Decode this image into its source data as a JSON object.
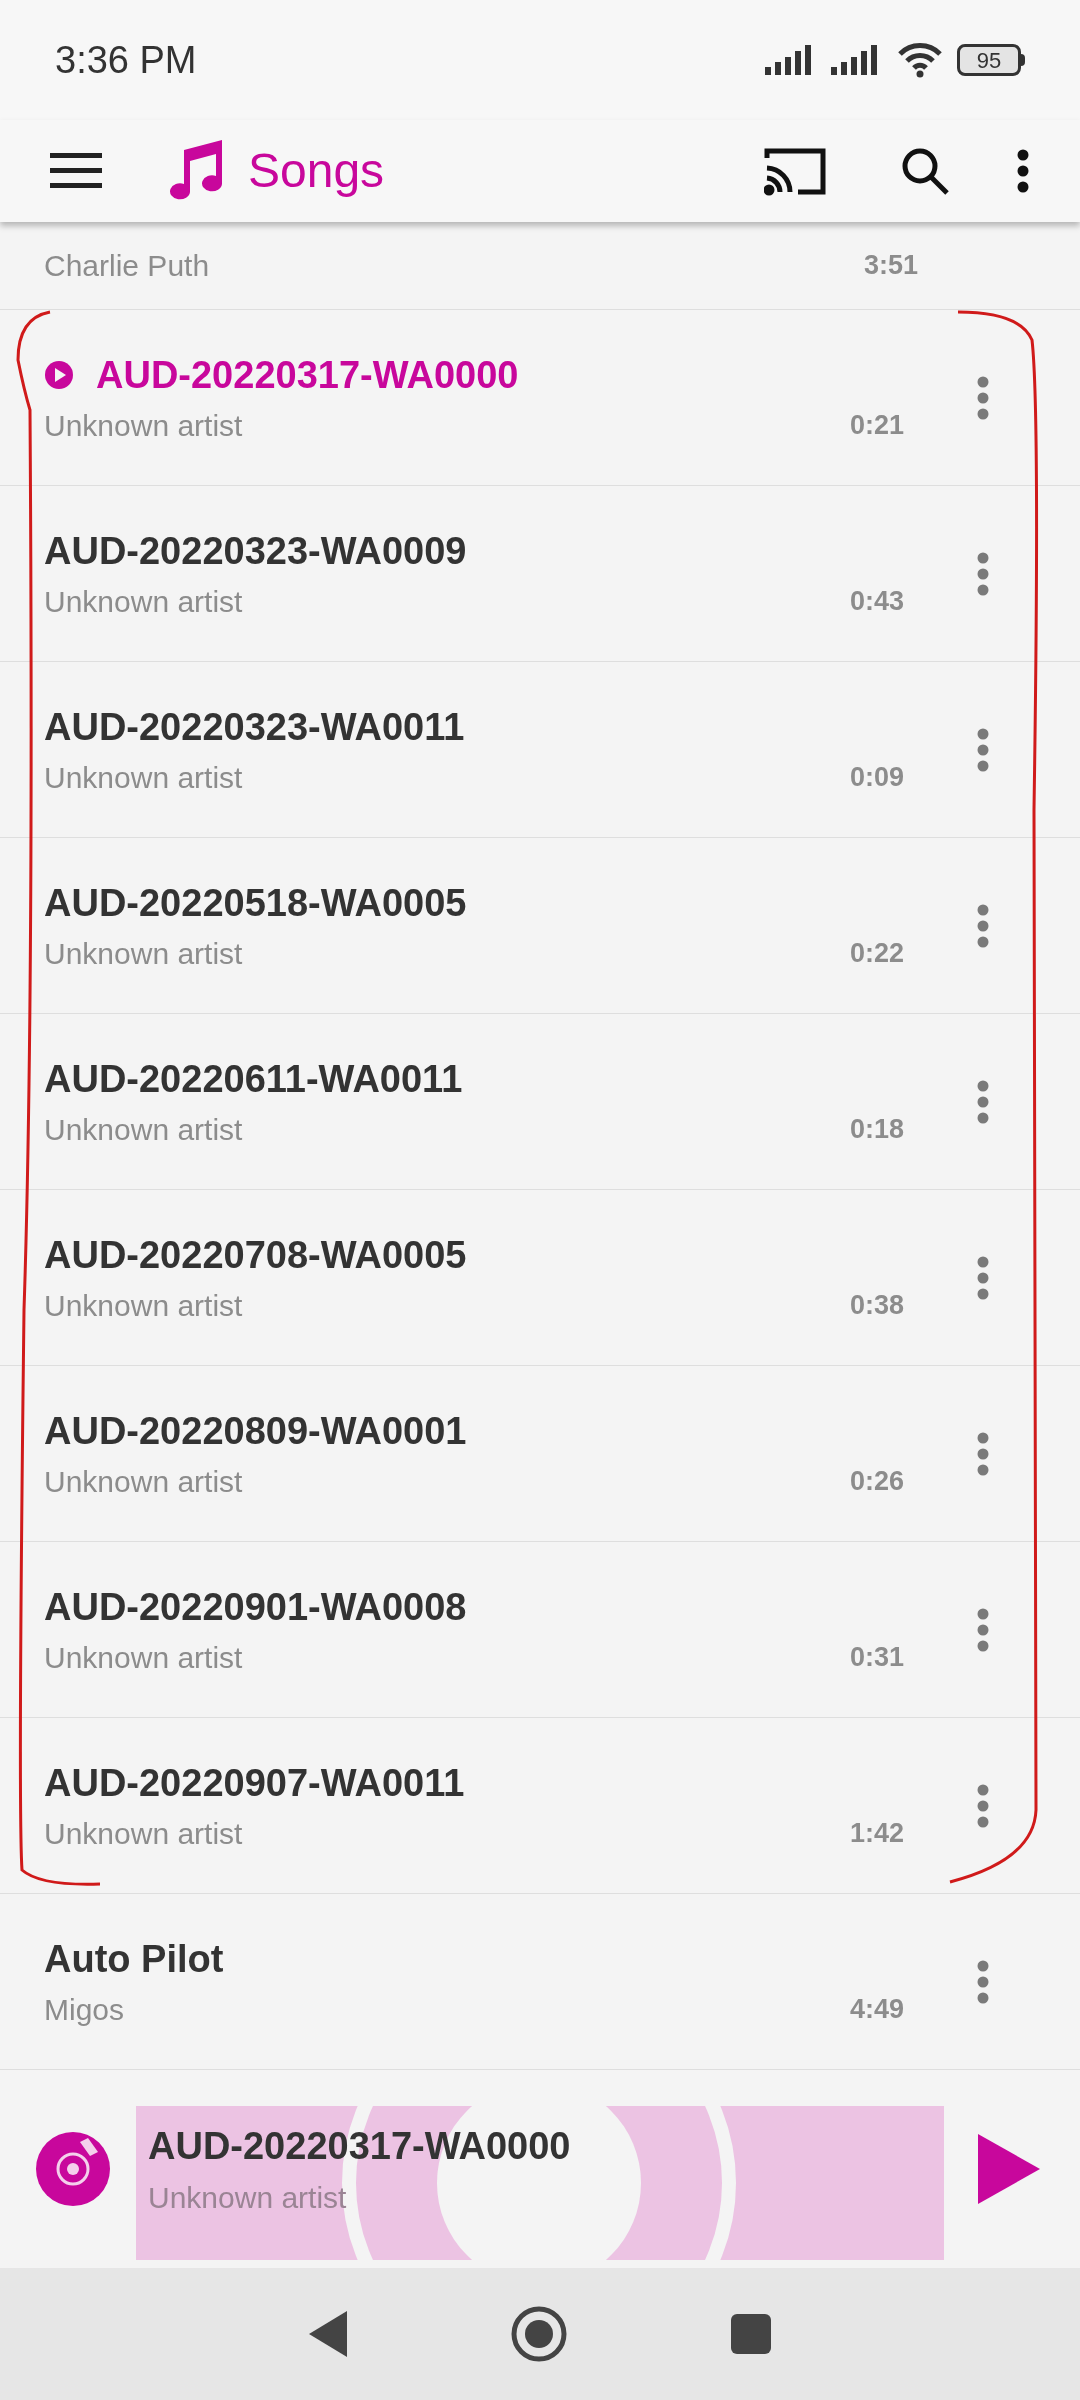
{
  "status_bar": {
    "time": "3:36 PM",
    "battery": "95"
  },
  "app_bar": {
    "title": "Songs"
  },
  "songs": [
    {
      "artist": "Charlie Puth",
      "duration": "3:51",
      "selected": false
    },
    {
      "title": "AUD-20220317-WA0000",
      "artist": "Unknown artist",
      "duration": "0:21",
      "selected": true
    },
    {
      "title": "AUD-20220323-WA0009",
      "artist": "Unknown artist",
      "duration": "0:43",
      "selected": false
    },
    {
      "title": "AUD-20220323-WA0011",
      "artist": "Unknown artist",
      "duration": "0:09",
      "selected": false
    },
    {
      "title": "AUD-20220518-WA0005",
      "artist": "Unknown artist",
      "duration": "0:22",
      "selected": false
    },
    {
      "title": "AUD-20220611-WA0011",
      "artist": "Unknown artist",
      "duration": "0:18",
      "selected": false
    },
    {
      "title": "AUD-20220708-WA0005",
      "artist": "Unknown artist",
      "duration": "0:38",
      "selected": false
    },
    {
      "title": "AUD-20220809-WA0001",
      "artist": "Unknown artist",
      "duration": "0:26",
      "selected": false
    },
    {
      "title": "AUD-20220901-WA0008",
      "artist": "Unknown artist",
      "duration": "0:31",
      "selected": false
    },
    {
      "title": "AUD-20220907-WA0011",
      "artist": "Unknown artist",
      "duration": "1:42",
      "selected": false
    },
    {
      "title": "Auto Pilot",
      "artist": "Migos",
      "duration": "4:49",
      "selected": false
    }
  ],
  "now_playing": {
    "title": "AUD-20220317-WA0000",
    "artist": "Unknown artist"
  }
}
